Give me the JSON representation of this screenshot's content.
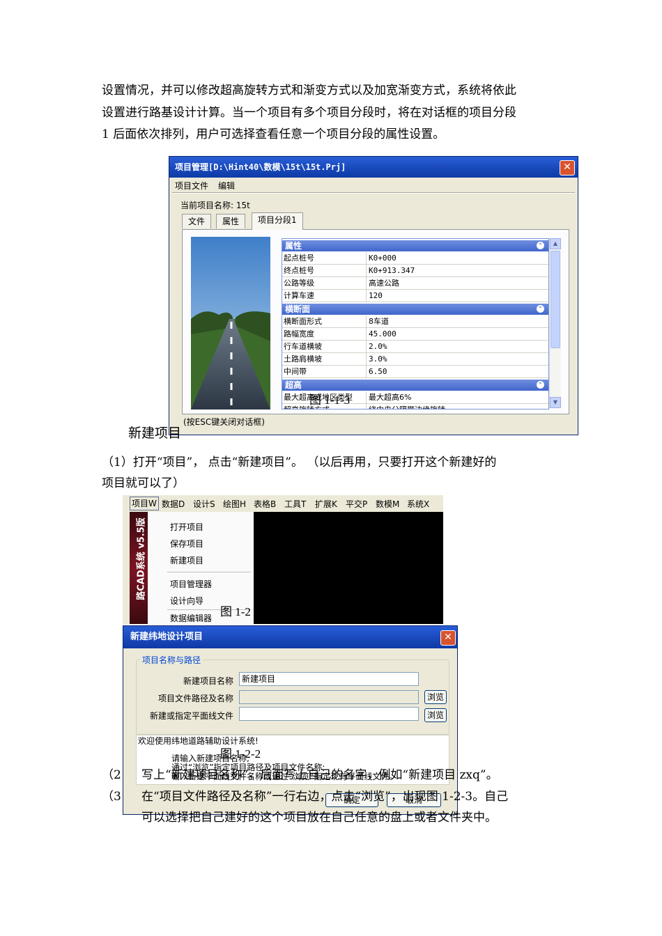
{
  "para1": {
    "line1": "设置情况，并可以修改超高旋转方式和渐变方式以及加宽渐变方式，系统将依此",
    "line2": "设置进行路基设计计算。当一个项目有多个项目分段时，将在对话框的项目分段",
    "line3": "1 后面依次排列，用户可选择查看任意一个项目分段的属性设置。"
  },
  "project_manager": {
    "title": "项目管理[D:\\Hint40\\数模\\15t\\15t.Prj]",
    "menu": [
      "项目文件",
      "编辑"
    ],
    "current_project": "当前项目名称: 15t",
    "tabs": [
      "文件",
      "属性",
      "项目分段1"
    ],
    "groups": [
      {
        "name": "属性",
        "rows": [
          {
            "k": "起点桩号",
            "v": "K0+000"
          },
          {
            "k": "终点桩号",
            "v": "K0+913.347"
          },
          {
            "k": "公路等级",
            "v": "高速公路"
          },
          {
            "k": "计算车速",
            "v": "120"
          }
        ]
      },
      {
        "name": "横断面",
        "rows": [
          {
            "k": "横断面形式",
            "v": "8车道"
          },
          {
            "k": "路幅宽度",
            "v": "45.000"
          },
          {
            "k": "行车道横坡",
            "v": "2.0%"
          },
          {
            "k": "土路肩横坡",
            "v": "3.0%"
          },
          {
            "k": "中间带",
            "v": "6.50"
          }
        ]
      },
      {
        "name": "超高",
        "rows": [
          {
            "k": "最大超高或地区类型",
            "v": "最大超高6%"
          },
          {
            "k": "超高旋转方式",
            "v": "绕中央分隔带边缘旋转"
          }
        ]
      }
    ],
    "footer": "(按ESC键关闭对话框)",
    "overlay_caption": "图 1-1-3"
  },
  "heading_new_project": "新建项目",
  "step1": {
    "line1": "（1）打开“项目”， 点击“新建项目”。 （以后再用，只要打开这个新建好的",
    "line2": "项目就可以了）"
  },
  "cad": {
    "menubar": [
      "项目W",
      "数据D",
      "设计S",
      "绘图H",
      "表格B",
      "工具T",
      "扩展K",
      "平交P",
      "数模M",
      "系统X"
    ],
    "banner": "路CAD系统 v5.5版",
    "items": [
      "打开项目",
      "保存项目",
      "新建项目",
      "项目管理器",
      "设计向导",
      "数据编辑器"
    ],
    "caption": "图 1-2"
  },
  "new_project": {
    "title": "新建纬地设计项目",
    "group_title": "项目名称与路径",
    "labels": [
      "新建项目名称",
      "项目文件路径及名称",
      "新建或指定平面线文件"
    ],
    "name_value": "新建项目",
    "browse": "浏览",
    "welcome": "欢迎使用纬地道路辅助设计系统!",
    "hint1": "请输入新建项目名称;",
    "hint2": "通过“浏览”指定项目路径及项目文件名称;",
    "hint3": "输入新建平面线文件名称或通过“浏览”指定现有平面线文件。",
    "ok": "确定",
    "cancel": "取消",
    "caption": "图 1-2-2"
  },
  "step2": {
    "num": "（2",
    "text": "写上“新建项目名称”，后面写上自己的名字，例如“新建项目 zxq”。"
  },
  "step3": {
    "num": "（3",
    "line1": "在“项目文件路径及名称”一行右边，点击“浏览”，出现图 1-2-3。自己",
    "line2": "可以选择把自己建好的这个项目放在自己任意的盘上或者文件夹中。"
  }
}
